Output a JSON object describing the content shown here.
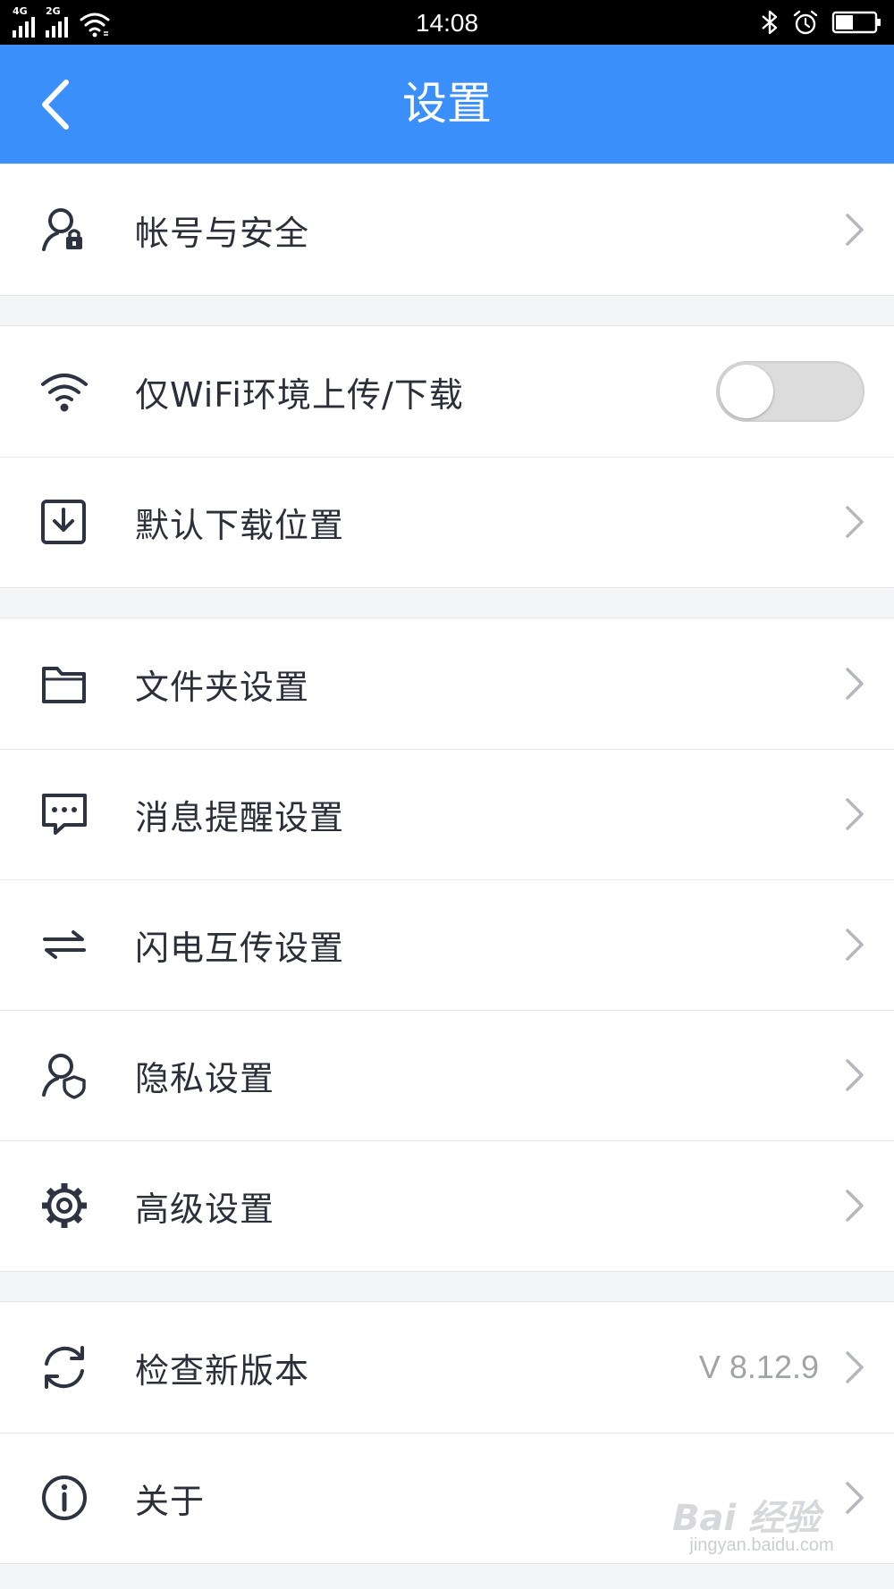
{
  "status_bar": {
    "time": "14:08",
    "network_1": "4G",
    "network_2": "2G",
    "battery_percent": 45
  },
  "header": {
    "title": "设置",
    "back_icon": "chevron-left-icon"
  },
  "sections": [
    {
      "items": [
        {
          "id": "account-security",
          "label": "帐号与安全",
          "icon": "user-lock-icon",
          "control": "chevron"
        }
      ]
    },
    {
      "items": [
        {
          "id": "wifi-only",
          "label": "仅WiFi环境上传/下载",
          "icon": "wifi-icon",
          "control": "toggle",
          "toggle_on": false
        },
        {
          "id": "download-location",
          "label": "默认下载位置",
          "icon": "download-box-icon",
          "control": "chevron"
        }
      ]
    },
    {
      "items": [
        {
          "id": "folder-settings",
          "label": "文件夹设置",
          "icon": "folder-icon",
          "control": "chevron"
        },
        {
          "id": "notification-settings",
          "label": "消息提醒设置",
          "icon": "message-icon",
          "control": "chevron"
        },
        {
          "id": "flash-transfer-settings",
          "label": "闪电互传设置",
          "icon": "transfer-arrows-icon",
          "control": "chevron"
        },
        {
          "id": "privacy-settings",
          "label": "隐私设置",
          "icon": "user-shield-icon",
          "control": "chevron"
        },
        {
          "id": "advanced-settings",
          "label": "高级设置",
          "icon": "gear-icon",
          "control": "chevron"
        }
      ]
    },
    {
      "items": [
        {
          "id": "check-update",
          "label": "检查新版本",
          "icon": "refresh-icon",
          "control": "chevron",
          "value": "V 8.12.9"
        },
        {
          "id": "about",
          "label": "关于",
          "icon": "info-icon",
          "control": "chevron"
        }
      ]
    }
  ],
  "watermark": {
    "logo": "Bai 经验",
    "sub": "jingyan.baidu.com"
  },
  "colors": {
    "header_bg": "#3b8ffb",
    "icon": "#2d3340",
    "chevron": "#b4b7bc",
    "page_bg": "#f4f5f7"
  }
}
